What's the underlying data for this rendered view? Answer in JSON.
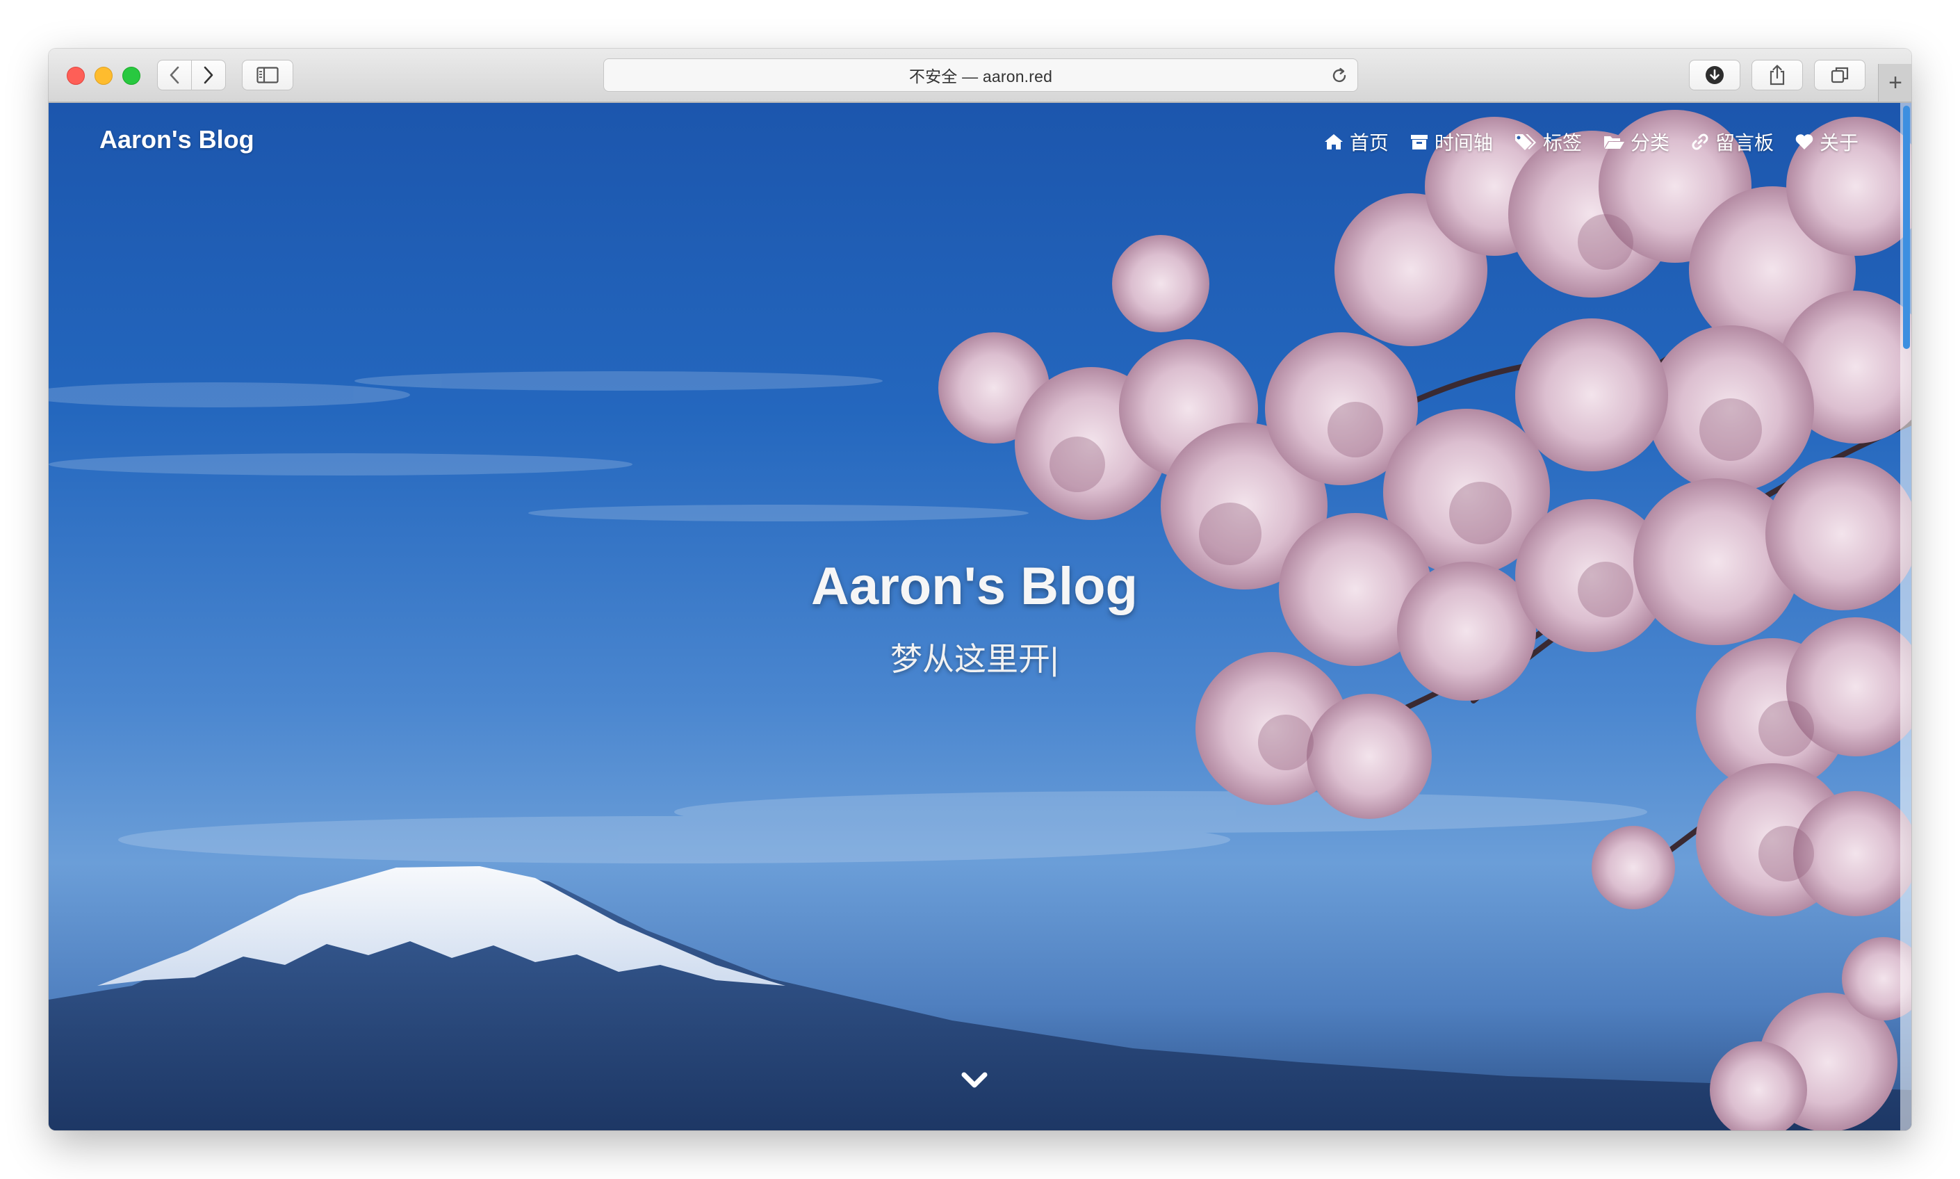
{
  "browser": {
    "address_text": "不安全 — aaron.red",
    "new_tab_label": "+"
  },
  "site": {
    "brand": "Aaron's Blog",
    "nav": [
      {
        "label": "首页",
        "icon": "home-icon"
      },
      {
        "label": "时间轴",
        "icon": "archive-icon"
      },
      {
        "label": "标签",
        "icon": "tags-icon"
      },
      {
        "label": "分类",
        "icon": "folder-open-icon"
      },
      {
        "label": "留言板",
        "icon": "link-icon"
      },
      {
        "label": "关于",
        "icon": "heart-icon"
      }
    ],
    "hero_title": "Aaron's Blog",
    "hero_subtitle": "梦从这里开|"
  },
  "colors": {
    "sky": "#2467be",
    "scroll_accent": "#3d8fe0"
  }
}
